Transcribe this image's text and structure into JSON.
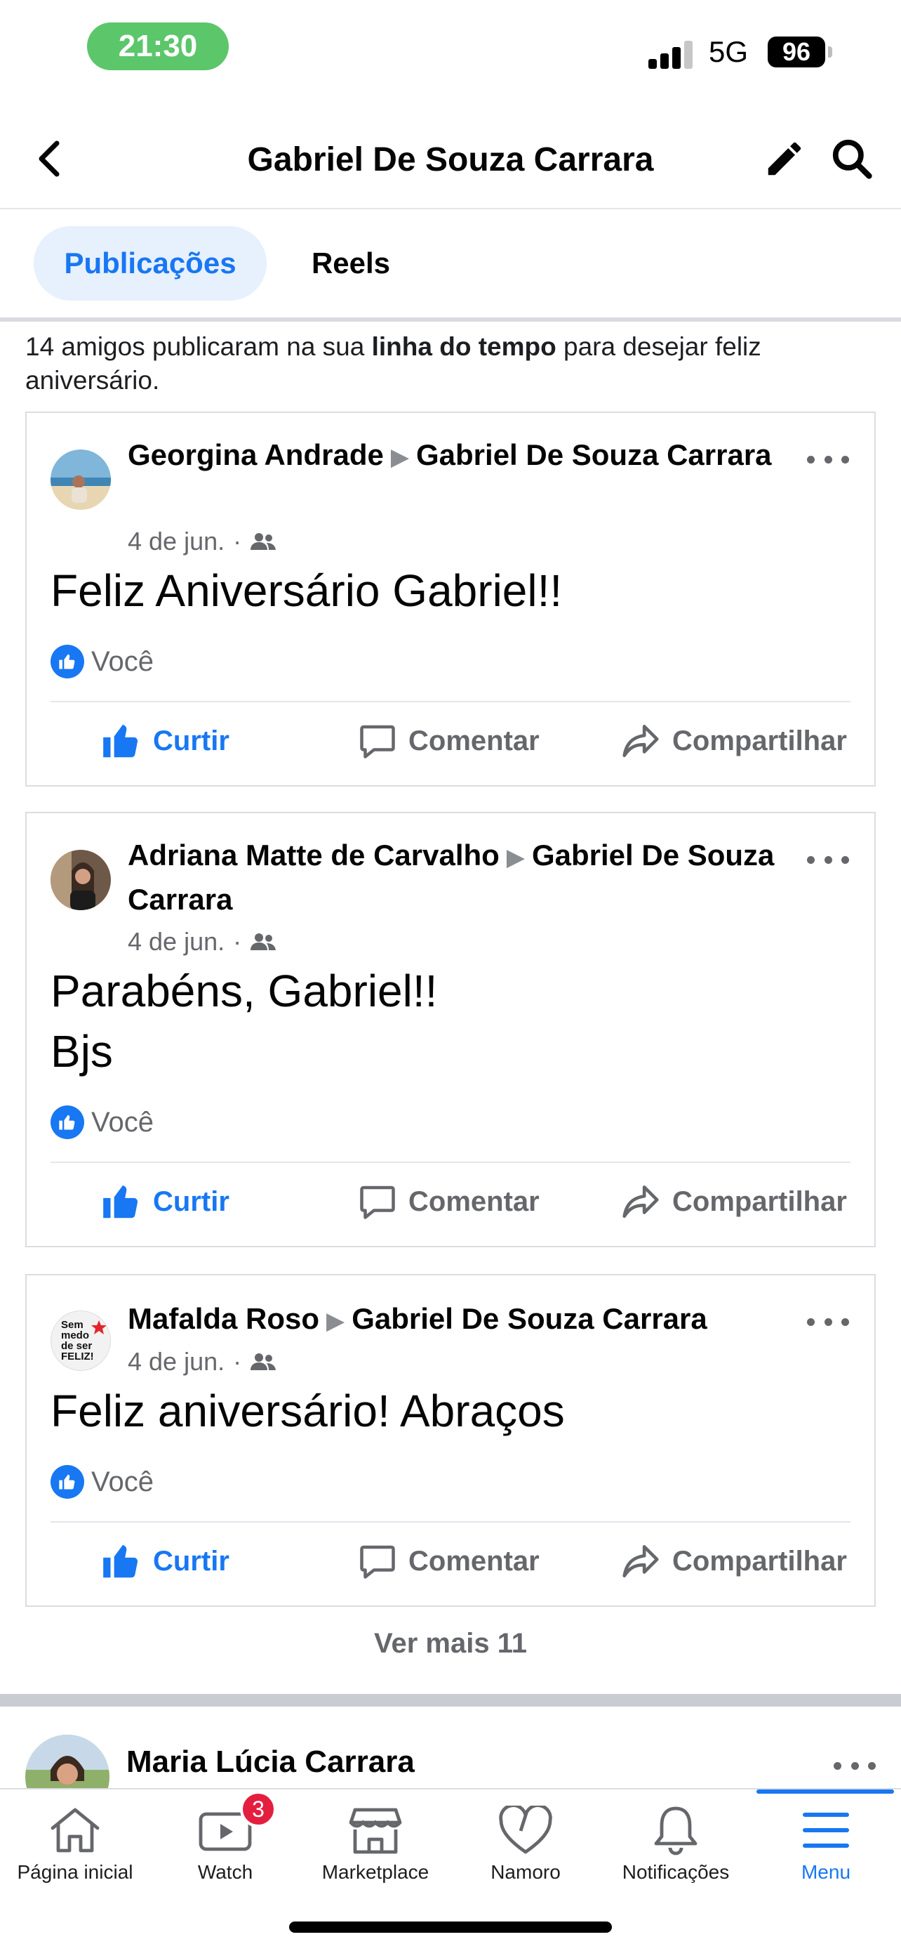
{
  "status_bar": {
    "time": "21:30",
    "network": "5G",
    "battery": "96",
    "time_color": "#5cc66a"
  },
  "header": {
    "title": "Gabriel De Souza Carrara",
    "back_icon": "chevron-left-icon",
    "edit_icon": "pencil-icon",
    "search_icon": "search-icon"
  },
  "tabs": [
    {
      "label": "Publicações",
      "active": true
    },
    {
      "label": "Reels",
      "active": false
    }
  ],
  "intro": {
    "part1": "14 amigos publicaram na sua ",
    "bold": "linha do tempo",
    "part2": " para desejar feliz aniversário."
  },
  "posts": [
    {
      "author": "Georgina Andrade",
      "target": "Gabriel De Souza Carrara",
      "date": "4 de jun.",
      "privacy_icon": "friends-icon",
      "text": "Feliz Aniversário Gabriel!!",
      "reaction": "Você"
    },
    {
      "author": "Adriana Matte de Carvalho",
      "target": "Gabriel De Souza Carrara",
      "date": "4 de jun.",
      "privacy_icon": "friends-icon",
      "text_line1": "Parabéns, Gabriel!!",
      "text_line2": "Bjs",
      "reaction": "Você"
    },
    {
      "author": "Mafalda Roso",
      "target": "Gabriel De Souza Carrara",
      "date": "4 de jun.",
      "privacy_icon": "friends-icon",
      "text": "Feliz aniversário! Abraços",
      "reaction": "Você",
      "avatar_text": [
        "Sem",
        "medo",
        "de ser",
        "FELIZ!"
      ]
    }
  ],
  "actions": {
    "like": "Curtir",
    "comment": "Comentar",
    "share": "Compartilhar"
  },
  "see_more": "Ver mais 11",
  "next_post": {
    "author": "Maria Lúcia Carrara"
  },
  "tabbar": [
    {
      "label": "Página inicial",
      "icon": "home-icon"
    },
    {
      "label": "Watch",
      "icon": "watch-icon",
      "badge": "3"
    },
    {
      "label": "Marketplace",
      "icon": "marketplace-icon"
    },
    {
      "label": "Namoro",
      "icon": "heart-icon"
    },
    {
      "label": "Notificações",
      "icon": "bell-icon"
    },
    {
      "label": "Menu",
      "icon": "menu-icon",
      "active": true
    }
  ],
  "colors": {
    "accent": "#1877f2",
    "secondary_text": "#65676b",
    "badge": "#e41e3f"
  }
}
